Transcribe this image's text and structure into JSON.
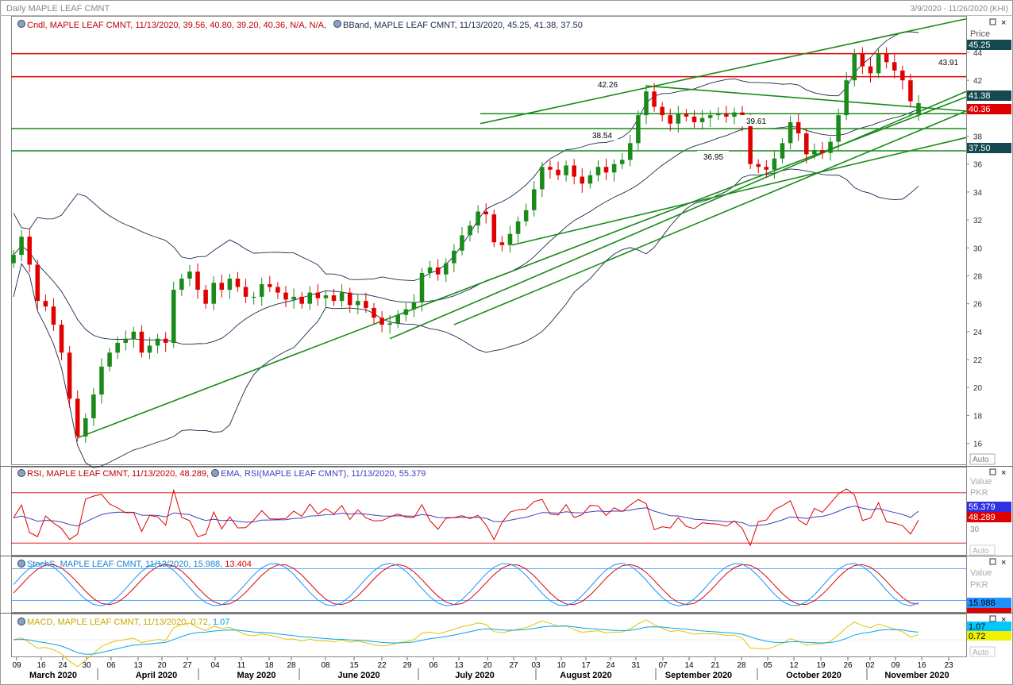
{
  "header": {
    "title": "Daily MAPLE LEAF CMNT",
    "date_range": "3/9/2020 - 11/26/2020 (KHI)"
  },
  "price_panel": {
    "cndl_legend": "Cndl, MAPLE LEAF CMNT, 11/13/2020, 39.56, 40.80, 39.20, 40.36, N/A, N/A,",
    "bband_legend": "BBand, MAPLE LEAF CMNT, 11/13/2020, 45.25, 41.38, 37.50",
    "axis_title": "Price",
    "auto_label": "Auto",
    "tags": {
      "upper": "45.25",
      "mid": "41.38",
      "last": "40.36",
      "lower": "37.50"
    },
    "hline_labels": {
      "h1": "43.91",
      "h2": "42.26",
      "h3": "39.61",
      "h4": "38.54",
      "h5": "36.95"
    }
  },
  "rsi_panel": {
    "rsi_legend": "RSI, MAPLE LEAF CMNT, 11/13/2020, 48.289,",
    "ema_legend": "EMA, RSI(MAPLE LEAF CMNT), 11/13/2020, 55.379",
    "axis_title": "Value",
    "currency": "PKR",
    "level_label": "30",
    "tag_ema": "55.379",
    "tag_rsi": "48.289",
    "auto_label": "Auto"
  },
  "stoch_panel": {
    "legend_name": "StochS, MAPLE LEAF CMNT, 11/13/2020,",
    "legend_k": "15.988,",
    "legend_d": "13.404",
    "axis_title": "Value",
    "currency": "PKR",
    "tag_k": "15.988",
    "tag_d": "13.404"
  },
  "macd_panel": {
    "legend_name": "MACD, MAPLE LEAF CMNT, 11/13/2020,",
    "legend_macd": "0.72,",
    "legend_signal": "1.07",
    "tag_signal": "1.07",
    "tag_macd": "0.72",
    "auto_label": "Auto"
  },
  "colors": {
    "up": "#1a8a1a",
    "down": "#e00000",
    "band": "#1a2a4a",
    "trend": "#1a8a1a",
    "rsi": "#e00000",
    "ema": "#4040c0",
    "stoch_k": "#1e90ff",
    "stoch_d": "#e00000",
    "macd": "#e6c200",
    "signal": "#00a6e6"
  },
  "chart_data": {
    "type": "candlestick",
    "title": "Daily MAPLE LEAF CMNT",
    "y_axis": {
      "label": "Price",
      "range": [
        14.5,
        46.5
      ],
      "ticks": [
        "16",
        "18",
        "20",
        "22",
        "24",
        "26",
        "28",
        "30",
        "32",
        "34",
        "36",
        "38",
        "40",
        "42",
        "44"
      ]
    },
    "x_axis": {
      "day_ticks": [
        "09",
        "16",
        "24",
        "30",
        "06",
        "13",
        "20",
        "27",
        "04",
        "11",
        "18",
        "28",
        "08",
        "15",
        "22",
        "29",
        "06",
        "13",
        "20",
        "27",
        "03",
        "10",
        "17",
        "24",
        "31",
        "07",
        "14",
        "21",
        "28",
        "05",
        "12",
        "19",
        "26",
        "02",
        "09",
        "16",
        "23"
      ],
      "months": [
        "March 2020",
        "April 2020",
        "May 2020",
        "June 2020",
        "July 2020",
        "August 2020",
        "September 2020",
        "October 2020",
        "November 2020"
      ]
    },
    "last_candle": {
      "date": "11/13/2020",
      "open": 39.56,
      "high": 40.8,
      "low": 39.2,
      "close": 40.36
    },
    "bollinger_last": {
      "upper": 45.25,
      "middle": 41.38,
      "lower": 37.5
    },
    "horizontal_levels": [
      43.91,
      42.26,
      39.61,
      38.54,
      36.95
    ],
    "close_series": [
      29.5,
      30.8,
      28.8,
      26.2,
      25.8,
      24.5,
      22.5,
      19.2,
      16.5,
      17.8,
      19.5,
      21.5,
      22.5,
      23.2,
      23.5,
      24.0,
      22.5,
      23.0,
      23.5,
      23.2,
      27.0,
      27.8,
      28.3,
      27.0,
      26.0,
      27.5,
      27.0,
      27.8,
      27.2,
      26.5,
      26.5,
      27.4,
      27.2,
      26.8,
      26.3,
      26.5,
      26.0,
      26.8,
      26.4,
      26.6,
      26.2,
      26.8,
      25.9,
      26.2,
      25.7,
      25.0,
      24.5,
      24.6,
      25.2,
      25.6,
      26.1,
      28.2,
      28.6,
      28.1,
      28.9,
      29.8,
      30.9,
      31.6,
      32.6,
      32.4,
      30.4,
      30.2,
      31.0,
      31.9,
      32.7,
      34.2,
      35.8,
      35.6,
      35.2,
      35.9,
      35.1,
      34.6,
      35.2,
      35.8,
      35.4,
      36.0,
      36.3,
      37.5,
      39.5,
      41.2,
      40.1,
      39.5,
      38.9,
      39.6,
      39.4,
      39.0,
      39.3,
      39.5,
      39.6,
      39.4,
      39.7,
      39.0,
      36.0,
      35.8,
      35.6,
      36.4,
      37.5,
      39.0,
      38.2,
      36.7,
      37.0,
      36.8,
      37.6,
      39.5,
      42.0,
      43.9,
      43.0,
      42.5,
      43.9,
      43.3,
      42.7,
      42.0,
      40.5,
      40.36
    ],
    "rsi": {
      "last": 48.289,
      "ema_last": 55.379,
      "levels": [
        70,
        30
      ]
    },
    "stochastic": {
      "k_last": 15.988,
      "d_last": 13.404,
      "levels": [
        80,
        20
      ]
    },
    "macd": {
      "macd_last": 0.72,
      "signal_last": 1.07
    }
  }
}
